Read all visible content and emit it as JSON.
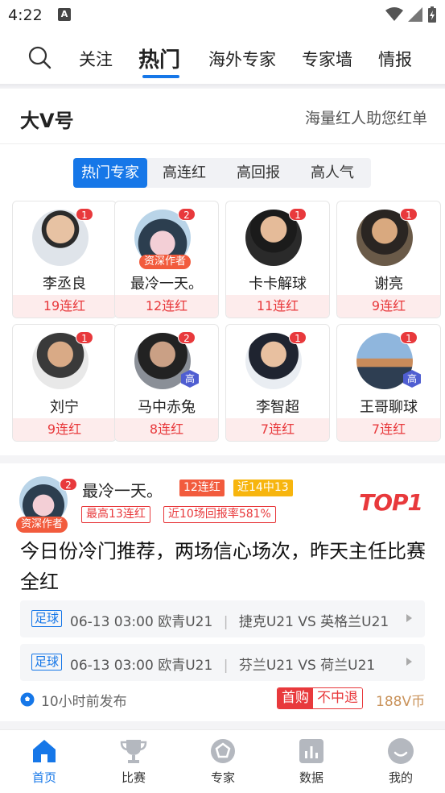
{
  "status": {
    "time": "4:22",
    "app_icon": "A"
  },
  "nav": {
    "tabs": [
      {
        "label": "关注"
      },
      {
        "label": "热门"
      },
      {
        "label": "海外专家"
      },
      {
        "label": "专家墙"
      },
      {
        "label": "情报"
      }
    ],
    "active": "热门"
  },
  "bigv": {
    "title": "大V号",
    "subtitle": "海量红人助您红单",
    "segments": [
      "热门专家",
      "高连红",
      "高回报",
      "高人气"
    ],
    "experts": [
      {
        "name": "李丞良",
        "streak": "19连红",
        "badge": "1"
      },
      {
        "name": "最冷一天。",
        "streak": "12连红",
        "badge": "2",
        "senior": "资深作者"
      },
      {
        "name": "卡卡解球",
        "streak": "11连红",
        "badge": "1"
      },
      {
        "name": "谢亮",
        "streak": "9连红",
        "badge": "1"
      },
      {
        "name": "刘宁",
        "streak": "9连红",
        "badge": "1"
      },
      {
        "name": "马中赤兔",
        "streak": "8连红",
        "badge": "2",
        "gao": "高"
      },
      {
        "name": "李智超",
        "streak": "7连红",
        "badge": "1"
      },
      {
        "name": "王哥聊球",
        "streak": "7连红",
        "badge": "1",
        "gao": "高"
      }
    ]
  },
  "article": {
    "author": "最冷一天。",
    "badge": "2",
    "senior": "资深作者",
    "tags": [
      "12连红",
      "近14中13",
      "最高13连红",
      "近10场回报率581%"
    ],
    "rank": "TOP1",
    "title": "今日份冷门推荐，两场信心场次，昨天主任比赛全红",
    "matches": [
      {
        "league": "足球",
        "time": "06-13 03:00",
        "competition": "欧青U21",
        "home": "捷克U21",
        "vs": "VS",
        "away": "英格兰U21"
      },
      {
        "league": "足球",
        "time": "06-13 03:00",
        "competition": "欧青U21",
        "home": "芬兰U21",
        "vs": "VS",
        "away": "荷兰U21"
      }
    ],
    "published": "10小时前发布",
    "buy_first": "首购",
    "buy_refund": "不中退",
    "price": "188V币"
  },
  "tabbar": {
    "items": [
      {
        "label": "首页",
        "icon": "home-icon"
      },
      {
        "label": "比赛",
        "icon": "trophy-icon"
      },
      {
        "label": "专家",
        "icon": "expert-icon"
      },
      {
        "label": "数据",
        "icon": "chart-icon"
      },
      {
        "label": "我的",
        "icon": "profile-icon"
      }
    ],
    "active": "首页"
  },
  "colors": {
    "accent": "#1677e8",
    "red": "#e8393c",
    "gold": "#c9925a"
  }
}
